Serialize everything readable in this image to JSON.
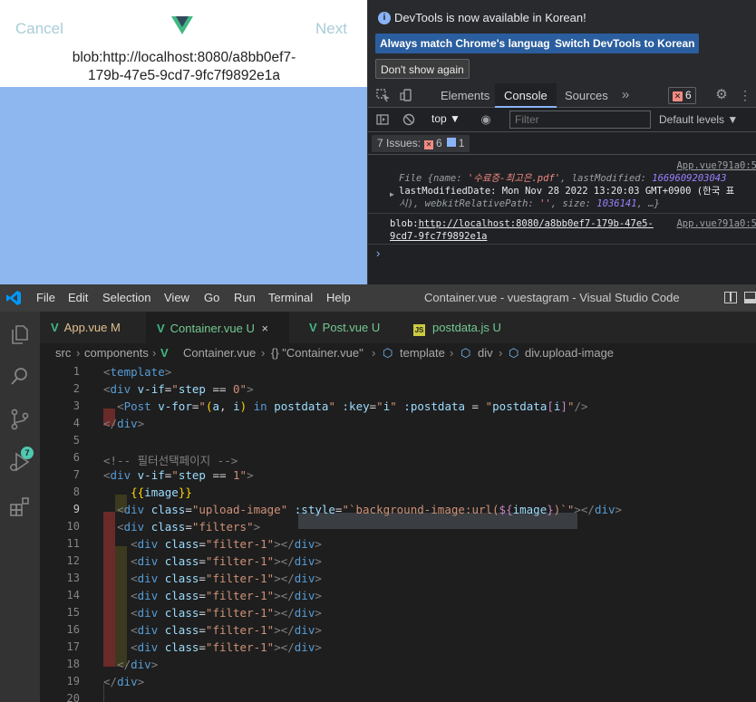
{
  "app": {
    "cancel_label": "Cancel",
    "next_label": "Next",
    "blob_text": "blob:http://localhost:8080/a8bb0ef7-\n179b-47e5-9cd7-9fc7f9892e1a"
  },
  "devtools": {
    "info_message": "DevTools is now available in Korean!",
    "buttons": {
      "match_language": "Always match Chrome's language",
      "switch_korean": "Switch DevTools to Korean",
      "dont_show": "Don't show again"
    },
    "tabs": [
      "Elements",
      "Console",
      "Sources"
    ],
    "active_tab": "Console",
    "error_count": "6",
    "context": "top",
    "filter_placeholder": "Filter",
    "levels": "Default levels",
    "issues": {
      "label": "7 Issues:",
      "errors": "6",
      "info": "1"
    },
    "log1": {
      "source": "App.vue?91a0:5",
      "line1_prefix": "File {",
      "name_key": "name: ",
      "name_val": "'수료증-최고은.pdf'",
      "lm_key": ", lastModified: ",
      "lm_val": "1669609203043",
      "line2": "lastModifiedDate: Mon Nov 28 2022 13:20:03 GMT+0900 (한국 표",
      "line3_prefix": "시), webkitRelativePath: ",
      "wrp_val": "''",
      "size_key": ", size: ",
      "size_val": "1036141",
      "line3_suffix": ", …}"
    },
    "log2": {
      "source": "App.vue?91a0:5",
      "prefix": "blob:",
      "link1": "http://localhost:8080/a8bb0ef7-179b-47e5-",
      "link2": "9cd7-9fc7f9892e1a"
    }
  },
  "vscode": {
    "menu": [
      "File",
      "Edit",
      "Selection",
      "View",
      "Go",
      "Run",
      "Terminal",
      "Help"
    ],
    "window_title": "Container.vue - vuestagram - Visual Studio Code",
    "scm_badge": "7",
    "tabs": [
      {
        "name": "App.vue",
        "status": "M"
      },
      {
        "name": "Container.vue",
        "status": "U"
      },
      {
        "name": "Post.vue",
        "status": "U"
      },
      {
        "name": "postdata.js",
        "status": "U"
      }
    ],
    "close_glyph": "×",
    "breadcrumbs": [
      "src",
      "components",
      "Container.vue",
      "{} \"Container.vue\"",
      "template",
      "div",
      "div.upload-image"
    ],
    "line_numbers": [
      "1",
      "2",
      "3",
      "4",
      "5",
      "6",
      "7",
      "8",
      "9",
      "10",
      "11",
      "12",
      "13",
      "14",
      "15",
      "16",
      "17",
      "18",
      "19",
      "20"
    ],
    "filter_div_line": "<div class=\"filter-1\"></div>"
  }
}
